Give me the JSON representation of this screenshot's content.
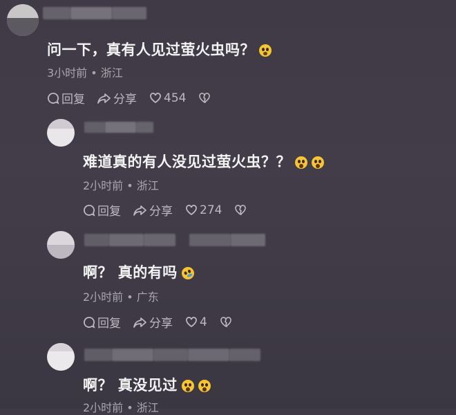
{
  "comments": [
    {
      "text": "问一下，真有人见过萤火虫吗？",
      "emoji_icons": [
        "relieved-face-emoji"
      ],
      "meta": "3小时前 • 浙江",
      "reply_label": "回复",
      "share_label": "分享",
      "likes": "454"
    },
    {
      "text": "难道真的有人没见过萤火虫？？",
      "emoji_icons": [
        "astonished-face-emoji",
        "astonished-face-emoji"
      ],
      "meta": "2小时前 • 浙江",
      "reply_label": "回复",
      "share_label": "分享",
      "likes": "274"
    },
    {
      "text": "啊？ 真的有吗",
      "emoji_icons": [
        "rolling-laughing-emoji"
      ],
      "meta": "2小时前 • 广东",
      "reply_label": "回复",
      "share_label": "分享",
      "likes": "4"
    },
    {
      "text": "啊？ 真没见过",
      "emoji_icons": [
        "astonished-face-emoji",
        "astonished-face-emoji"
      ],
      "meta": "2小时前 • 浙江"
    }
  ],
  "colors": {
    "background": "#413c47",
    "text": "#f3f3f3",
    "meta": "#a9a6ae"
  }
}
